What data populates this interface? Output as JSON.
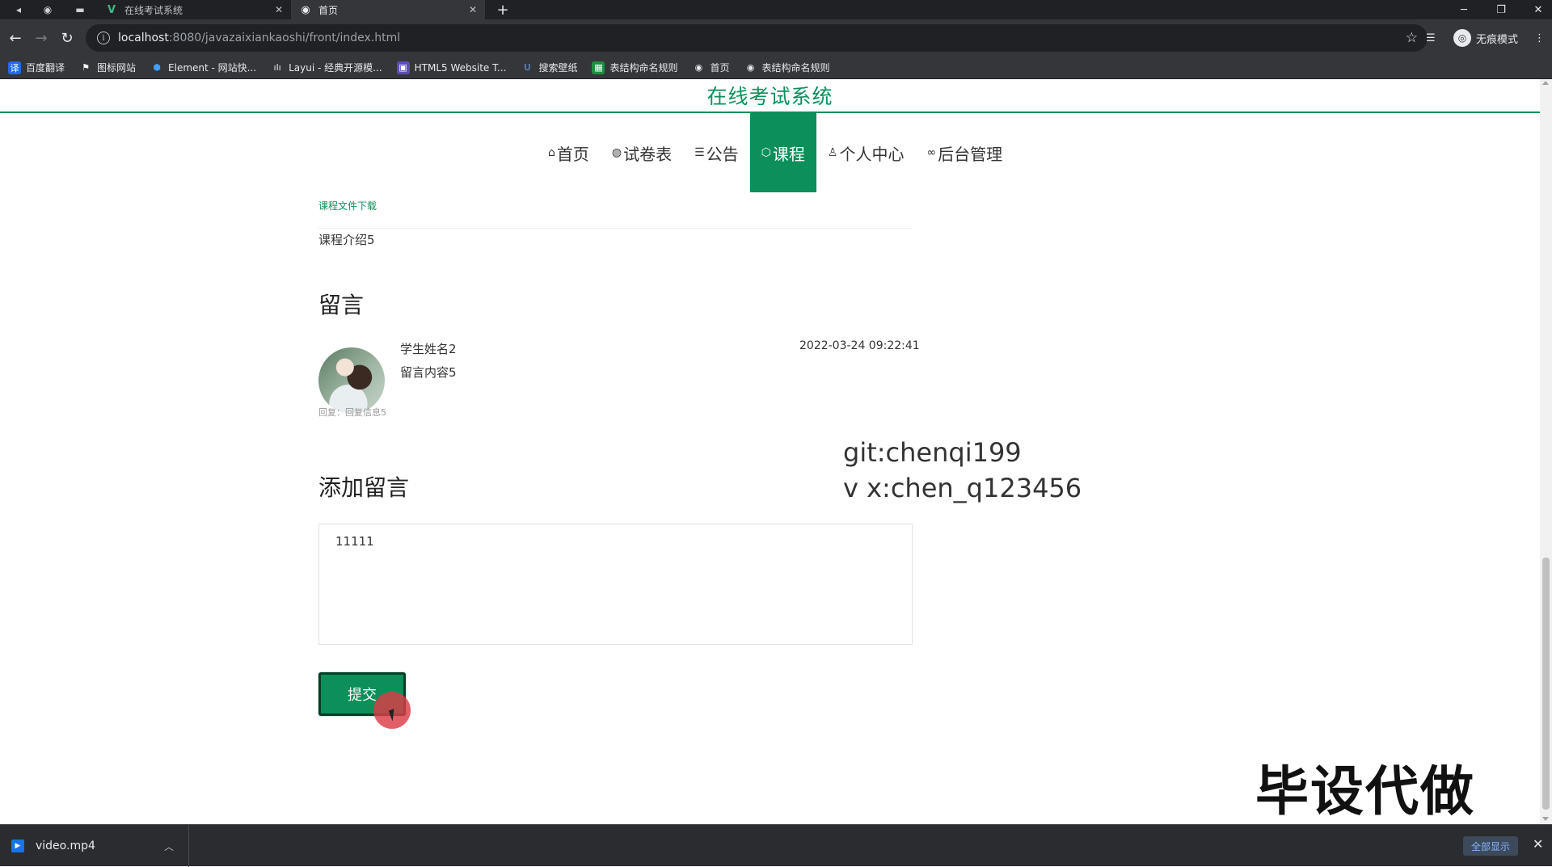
{
  "browser": {
    "tabs": [
      {
        "title": "在线考试系统",
        "favicon": "vue-logo-icon",
        "active": false
      },
      {
        "title": "首页",
        "favicon": "globe-icon",
        "active": true
      }
    ],
    "url_host": "localhost",
    "url_path": ":8080/javazaixiankaoshi/front/index.html",
    "incognito_label": "无痕模式",
    "bookmarks": [
      {
        "label": "百度翻译",
        "icon": "baidu-translate-icon"
      },
      {
        "label": "图标网站",
        "icon": "flag-icon"
      },
      {
        "label": "Element - 网站快...",
        "icon": "element-logo-icon"
      },
      {
        "label": "Layui - 经典开源模...",
        "icon": "layui-logo-icon"
      },
      {
        "label": "HTML5 Website T...",
        "icon": "html5-template-icon"
      },
      {
        "label": "搜索壁纸",
        "icon": "wallpaper-search-icon"
      },
      {
        "label": "表结构命名规则",
        "icon": "sheet-icon"
      },
      {
        "label": "首页",
        "icon": "globe-icon"
      },
      {
        "label": "表结构命名规则",
        "icon": "globe-icon"
      }
    ]
  },
  "site": {
    "title": "在线考试系统",
    "nav": [
      {
        "label": "首页",
        "icon": "home-icon",
        "active": false
      },
      {
        "label": "试卷表",
        "icon": "globe-icon",
        "active": false
      },
      {
        "label": "公告",
        "icon": "layers-icon",
        "active": false
      },
      {
        "label": "课程",
        "icon": "cube-icon",
        "active": true
      },
      {
        "label": "个人中心",
        "icon": "user-icon",
        "active": false
      },
      {
        "label": "后台管理",
        "icon": "link-icon",
        "active": false
      }
    ]
  },
  "course": {
    "file_download_link": "课程文件下载",
    "intro": "课程介绍5"
  },
  "comments": {
    "heading": "留言",
    "items": [
      {
        "name": "学生姓名2",
        "content": "留言内容5",
        "time": "2022-03-24 09:22:41",
        "reply": "回复：回复信息5"
      }
    ]
  },
  "add_comment": {
    "heading": "添加留言",
    "textarea_value": "11111",
    "submit_label": "提交"
  },
  "overlays": {
    "git_line": "git:chenqi199",
    "vx_line": "v x:chen_q123456",
    "big_watermark": "毕设代做"
  },
  "downloads": {
    "file_name": "video.mp4",
    "show_all_label": "全部显示"
  },
  "colors": {
    "brand_green": "#0d8f5a",
    "browser_dark": "#202124",
    "browser_toolbar": "#35363a"
  }
}
